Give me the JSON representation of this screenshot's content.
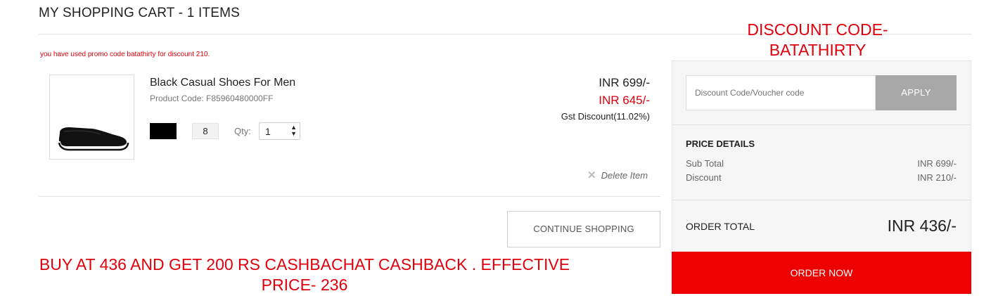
{
  "cart": {
    "title": "MY SHOPPING CART - 1 ITEMS",
    "promo_message": "you have used promo code batathirty for discount 210."
  },
  "item": {
    "name": "Black Casual Shoes For Men",
    "product_code": "Product Code: F85960480000FF",
    "color_swatch": "#000000",
    "size": "8",
    "qty_label": "Qty:",
    "qty_value": "1",
    "price_original": "INR 699/-",
    "price_sale": "INR 645/-",
    "gst_discount": "Gst Discount(11.02%)",
    "delete_label": "Delete Item"
  },
  "actions": {
    "continue_shopping": "CONTINUE SHOPPING",
    "order_now": "ORDER NOW"
  },
  "summary": {
    "code_placeholder": "Discount Code/Voucher code",
    "apply_label": "APPLY",
    "price_details_title": "PRICE DETAILS",
    "subtotal_label": "Sub Total",
    "subtotal_value": "INR 699/-",
    "discount_label": "Discount",
    "discount_value": "INR 210/-",
    "order_total_label": "ORDER TOTAL",
    "order_total_value": "INR 436/-"
  },
  "annotations": {
    "discount_code_line1": "DISCOUNT CODE-",
    "discount_code_line2": "BATATHIRTY",
    "cashback_line1": "BUY AT 436 AND GET 200 RS CASHBACHAT CASHBACK . EFFECTIVE",
    "cashback_line2": "PRICE- 236"
  },
  "colors": {
    "accent_red": "#e0000c",
    "order_button": "#ec0000",
    "apply_button": "#a8a8a8"
  }
}
